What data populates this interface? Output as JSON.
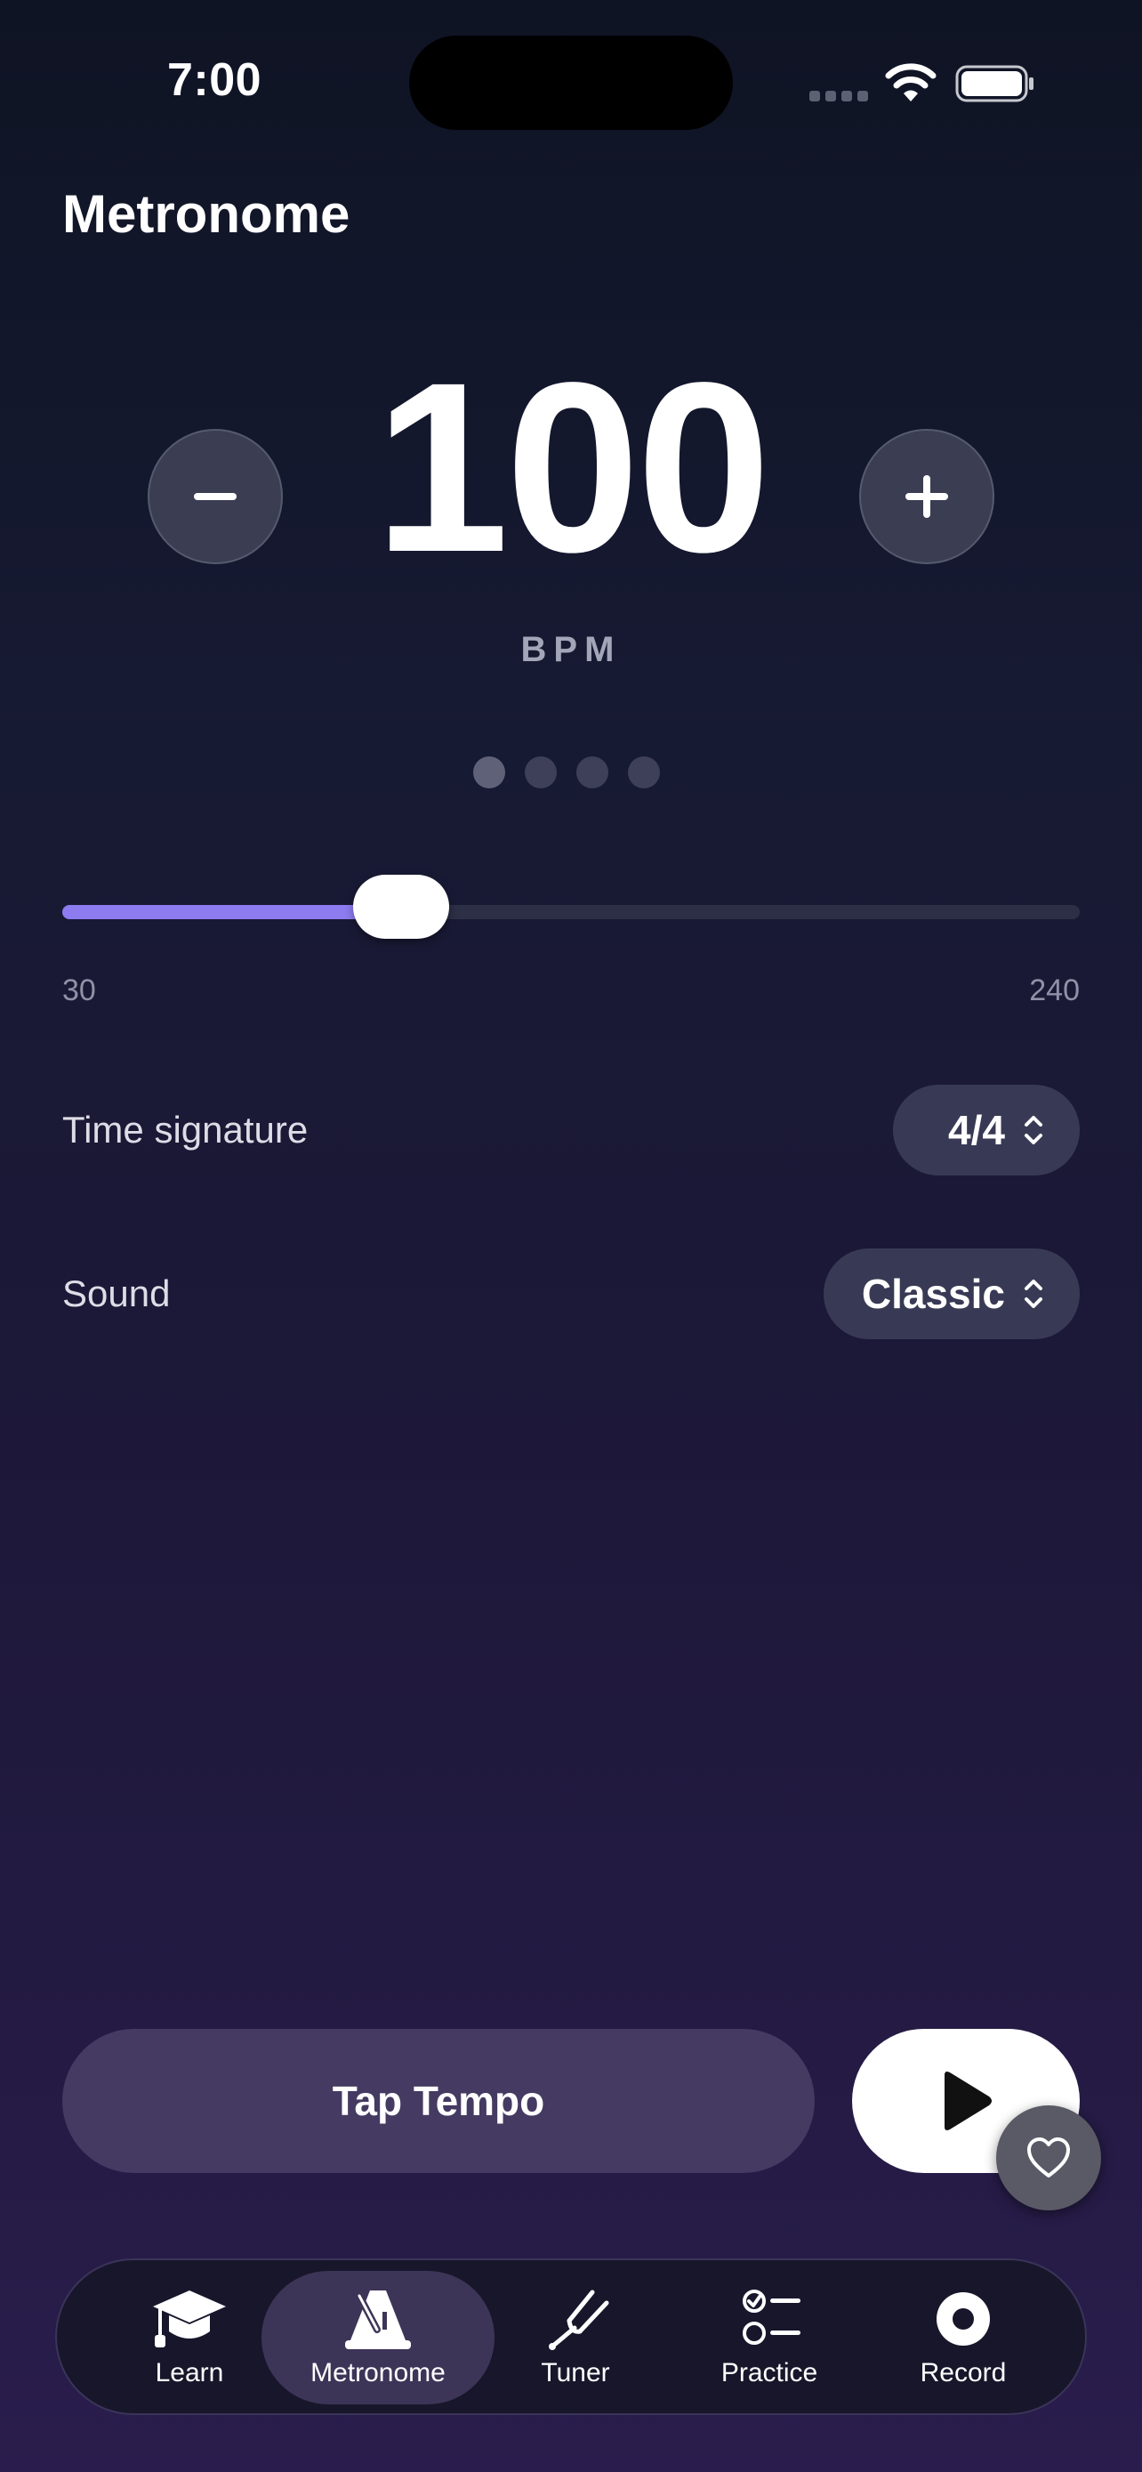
{
  "status_bar": {
    "time": "7:00"
  },
  "header": {
    "title": "Metronome"
  },
  "tempo": {
    "bpm": "100",
    "unit": "BPM",
    "beats_per_bar": 4,
    "active_beat": 1
  },
  "slider": {
    "min_label": "30",
    "max_label": "240",
    "min": 30,
    "max": 240,
    "value": 100
  },
  "settings": {
    "time_signature_label": "Time signature",
    "time_signature_value": "4/4",
    "sound_label": "Sound",
    "sound_value": "Classic"
  },
  "controls": {
    "tap_tempo_label": "Tap Tempo"
  },
  "tabs": [
    {
      "label": "Learn",
      "icon": "graduation-cap-icon"
    },
    {
      "label": "Metronome",
      "icon": "metronome-icon",
      "active": true
    },
    {
      "label": "Tuner",
      "icon": "tuning-fork-icon"
    },
    {
      "label": "Practice",
      "icon": "checklist-icon"
    },
    {
      "label": "Record",
      "icon": "record-icon"
    }
  ],
  "colors": {
    "accent": "#8c7cf0",
    "background_top": "#0f1424",
    "background_bottom": "#2a1d4d",
    "pill": "#383a55",
    "tap_button": "#443a62"
  }
}
